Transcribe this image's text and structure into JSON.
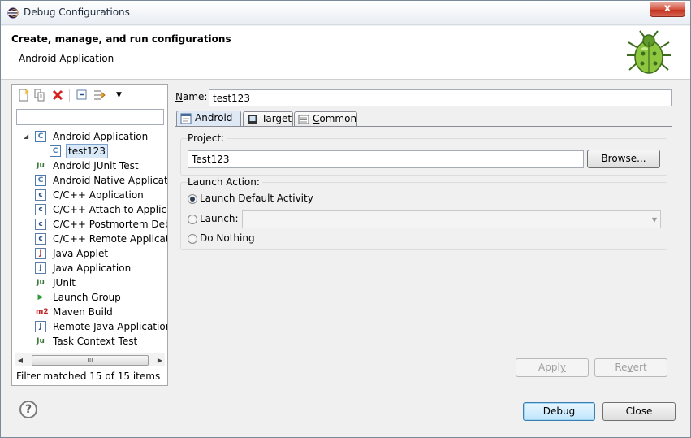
{
  "window": {
    "title": "Debug Configurations",
    "close_glyph": "x"
  },
  "header": {
    "title": "Create, manage, and run configurations",
    "subtitle": "Android Application"
  },
  "left": {
    "filter_placeholder": "",
    "tree": [
      {
        "label": "Android Application",
        "icon": "android-app-icon",
        "level": 0,
        "expanded": true
      },
      {
        "label": "test123",
        "icon": "android-app-icon",
        "level": 1,
        "selected": true
      },
      {
        "label": "Android JUnit Test",
        "icon": "junit-icon",
        "level": 0
      },
      {
        "label": "Android Native Applicatio",
        "icon": "android-app-icon",
        "level": 0
      },
      {
        "label": "C/C++ Application",
        "icon": "cpp-icon",
        "level": 0
      },
      {
        "label": "C/C++ Attach to Applicati",
        "icon": "cpp-icon",
        "level": 0
      },
      {
        "label": "C/C++ Postmortem Debu",
        "icon": "cpp-icon",
        "level": 0
      },
      {
        "label": "C/C++ Remote Applicatio",
        "icon": "cpp-icon",
        "level": 0
      },
      {
        "label": "Java Applet",
        "icon": "java-applet-icon",
        "level": 0
      },
      {
        "label": "Java Application",
        "icon": "java-app-icon",
        "level": 0
      },
      {
        "label": "JUnit",
        "icon": "junit-icon",
        "level": 0
      },
      {
        "label": "Launch Group",
        "icon": "launch-group-icon",
        "level": 0
      },
      {
        "label": "Maven Build",
        "icon": "maven-icon",
        "level": 0
      },
      {
        "label": "Remote Java Application",
        "icon": "remote-java-icon",
        "level": 0
      },
      {
        "label": "Task Context Test",
        "icon": "task-context-icon",
        "level": 0
      }
    ],
    "scroll_grip": "III",
    "filter_status": "Filter matched 15 of 15 items"
  },
  "main": {
    "name_label": "Name:",
    "name_value": "test123",
    "tabs": [
      {
        "label": "Android",
        "icon": "android-tab-icon",
        "active": true
      },
      {
        "label": "Target",
        "icon": "target-icon",
        "active": false
      },
      {
        "label": "Common",
        "icon": "common-icon",
        "active": false
      }
    ],
    "project_label": "Project:",
    "project_value": "Test123",
    "browse_label": "Browse...",
    "launch_action_label": "Launch Action:",
    "launch_options": [
      {
        "label": "Launch Default Activity",
        "checked": true
      },
      {
        "label": "Launch:",
        "checked": false
      },
      {
        "label": "Do Nothing",
        "checked": false
      }
    ],
    "launch_combo_value": "",
    "apply_label": "Apply",
    "revert_label": "Revert"
  },
  "footer": {
    "help_glyph": "?",
    "debug_label": "Debug",
    "close_label": "Close"
  }
}
